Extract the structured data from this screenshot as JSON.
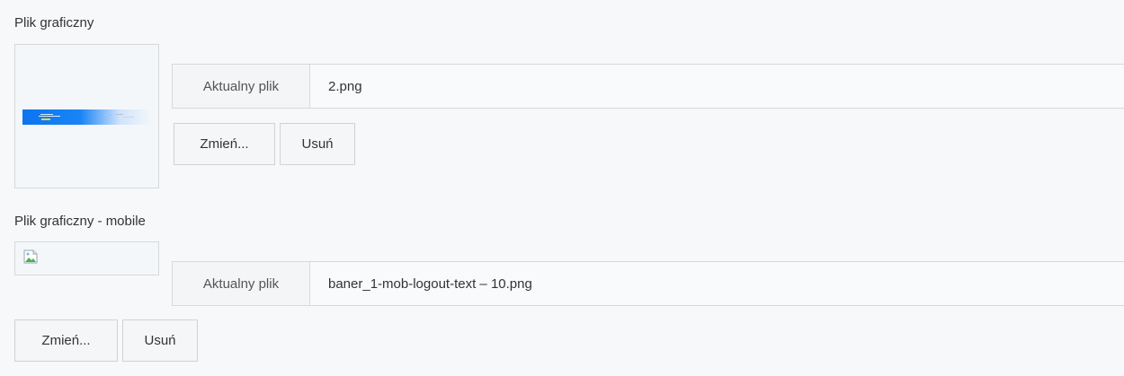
{
  "image_field": {
    "label": "Plik graficzny",
    "current_file_label": "Aktualny plik",
    "current_file_value": "2.png",
    "change_label": "Zmień...",
    "remove_label": "Usuń"
  },
  "image_mobile_field": {
    "label": "Plik graficzny - mobile",
    "current_file_label": "Aktualny plik",
    "current_file_value": "baner_1-mob-logout-text – 10.png",
    "change_label": "Zmień...",
    "remove_label": "Usuń"
  },
  "icons": {
    "broken_image": "broken-image-icon"
  },
  "colors": {
    "banner_blue": "#0b74f0",
    "background": "#f7f8f9",
    "border": "#d6dadd"
  }
}
